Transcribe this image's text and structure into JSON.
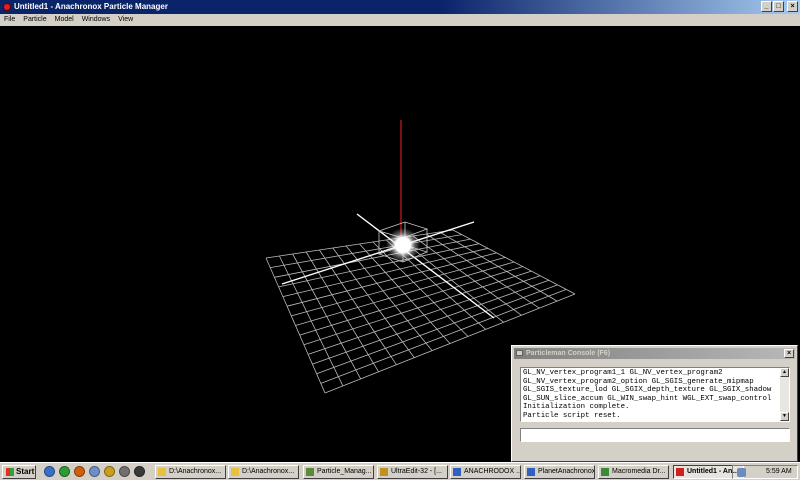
{
  "window": {
    "title": "Untitled1 - Anachronox Particle Manager",
    "buttons": [
      "_",
      "□",
      "×"
    ]
  },
  "menu": [
    "File",
    "Particle",
    "Model",
    "Windows",
    "View"
  ],
  "viewport": {
    "grid_color": "#bbbbbb",
    "axis_color": "#cc2020",
    "emitter_color": "#ffffff"
  },
  "console": {
    "title": "Particleman Console (F6)",
    "close": "×",
    "log": [
      "GL_NV_vertex_program1_1 GL_NV_vertex_program2",
      "GL_NV_vertex_program2_option GL_SGIS_generate_mipmap",
      "GL_SGIS_texture_lod GL_SGIX_depth_texture GL_SGIX_shadow",
      "GL_SUN_slice_accum GL_WIN_swap_hint WGL_EXT_swap_control",
      "Initialization complete.",
      "Particle script reset."
    ],
    "input_value": "",
    "scroll_up": "▲",
    "scroll_down": "▼"
  },
  "taskbar": {
    "start_label": "Start",
    "quick_launch_icons": [
      "ie-icon",
      "green-check-icon",
      "red-arrow-icon",
      "globe-icon",
      "biohazard-icon",
      "gear-icon",
      "media-icon"
    ],
    "tasks": [
      {
        "label": "D:\\Anachronox...",
        "icon": "folder-icon",
        "active": false
      },
      {
        "label": "D:\\Anachronox...",
        "icon": "folder-icon",
        "active": false
      },
      {
        "label": "Particle_Manag...",
        "icon": "document-icon",
        "active": false
      },
      {
        "label": "UltraEdit-32 - [...",
        "icon": "ultraedit-icon",
        "active": false
      },
      {
        "label": "ANACHRODOX ...",
        "icon": "web-icon",
        "active": false
      },
      {
        "label": "PlanetAnachronox",
        "icon": "web-icon",
        "active": false
      },
      {
        "label": "Macromedia Dr...",
        "icon": "dreamweaver-icon",
        "active": false
      },
      {
        "label": "Untitled1 - An...",
        "icon": "app-icon",
        "active": true
      }
    ],
    "clock": "5:59 AM"
  }
}
